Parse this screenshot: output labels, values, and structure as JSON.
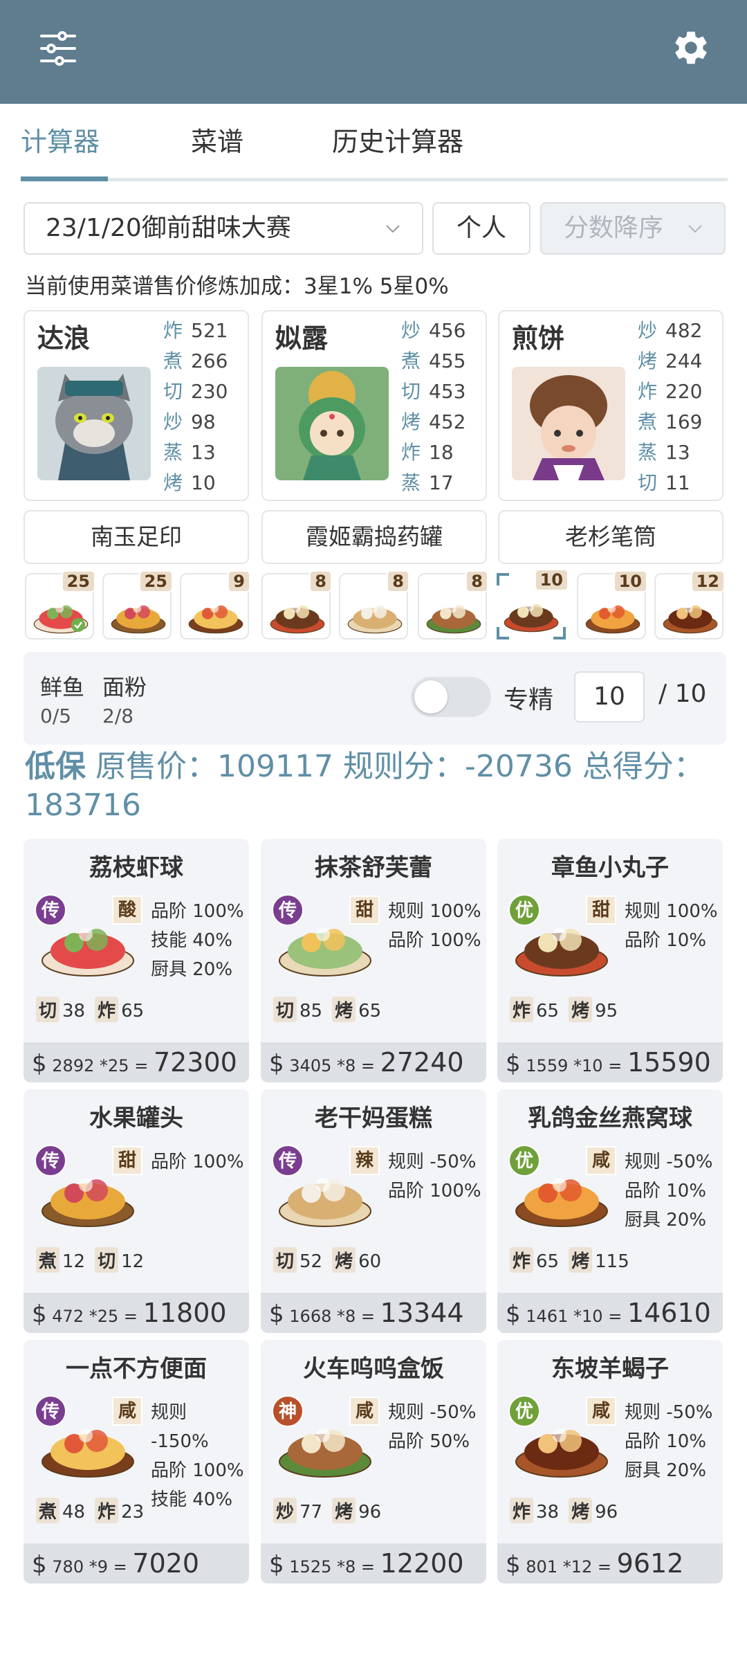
{
  "header": {
    "menu_icon": "sliders-icon",
    "settings_icon": "gear-icon",
    "bg_color": "#5f7d8f"
  },
  "tabs": [
    {
      "label": "计算器",
      "active": true
    },
    {
      "label": "菜谱",
      "active": false
    },
    {
      "label": "历史计算器",
      "active": false
    }
  ],
  "filters": {
    "contest": "23/1/20御前甜味大赛",
    "mode": "个人",
    "sort": "分数降序"
  },
  "hint": "当前使用菜谱售价修炼加成：3星1% 5星0%",
  "chefs": [
    {
      "name": "达浪",
      "stats": [
        {
          "k": "炸",
          "v": "521"
        },
        {
          "k": "煮",
          "v": "266"
        },
        {
          "k": "切",
          "v": "230"
        },
        {
          "k": "炒",
          "v": "98"
        },
        {
          "k": "蒸",
          "v": "13"
        },
        {
          "k": "烤",
          "v": "10"
        }
      ],
      "equip": "南玉足印"
    },
    {
      "name": "姒露",
      "stats": [
        {
          "k": "炒",
          "v": "456"
        },
        {
          "k": "煮",
          "v": "455"
        },
        {
          "k": "切",
          "v": "453"
        },
        {
          "k": "烤",
          "v": "452"
        },
        {
          "k": "炸",
          "v": "18"
        },
        {
          "k": "蒸",
          "v": "17"
        }
      ],
      "equip": "霞姬霸捣药罐"
    },
    {
      "name": "煎饼",
      "stats": [
        {
          "k": "炒",
          "v": "482"
        },
        {
          "k": "烤",
          "v": "244"
        },
        {
          "k": "炸",
          "v": "220"
        },
        {
          "k": "煮",
          "v": "169"
        },
        {
          "k": "蒸",
          "v": "13"
        },
        {
          "k": "切",
          "v": "11"
        }
      ],
      "equip": "老杉笔筒"
    }
  ],
  "strip_counts": [
    "25",
    "25",
    "9",
    "8",
    "8",
    "8",
    "10",
    "10",
    "12"
  ],
  "panel": {
    "ing1_name": "鲜鱼",
    "ing1_val": "0/5",
    "ing2_name": "面粉",
    "ing2_val": "2/8",
    "toggle_label": "专精",
    "count_value": "10",
    "count_max": "/ 10"
  },
  "summary": {
    "tag": "低保",
    "text1": "原售价：",
    "orig": "109117",
    "text2": "规则分：",
    "rule": "-20736",
    "text3": "总得分：",
    "total": "183716"
  },
  "recipes": [
    {
      "name": "荔枝虾球",
      "rarity": "传",
      "taste": "酸",
      "bonus": [
        "品阶 100%",
        "技能 40%",
        "厨具 20%"
      ],
      "skills": [
        {
          "k": "切",
          "v": "38"
        },
        {
          "k": "炸",
          "v": "65"
        }
      ],
      "price": "2892",
      "mult": "*25",
      "total": "72300"
    },
    {
      "name": "抹茶舒芙蕾",
      "rarity": "传",
      "taste": "甜",
      "bonus": [
        "规则 100%",
        "品阶 100%"
      ],
      "skills": [
        {
          "k": "切",
          "v": "85"
        },
        {
          "k": "烤",
          "v": "65"
        }
      ],
      "price": "3405",
      "mult": "*8",
      "total": "27240"
    },
    {
      "name": "章鱼小丸子",
      "rarity": "优",
      "taste": "甜",
      "bonus": [
        "规则 100%",
        "品阶 10%"
      ],
      "skills": [
        {
          "k": "炸",
          "v": "65"
        },
        {
          "k": "烤",
          "v": "95"
        }
      ],
      "price": "1559",
      "mult": "*10",
      "total": "15590"
    },
    {
      "name": "水果罐头",
      "rarity": "传",
      "taste": "甜",
      "bonus": [
        "品阶 100%"
      ],
      "skills": [
        {
          "k": "煮",
          "v": "12"
        },
        {
          "k": "切",
          "v": "12"
        }
      ],
      "price": "472",
      "mult": "*25",
      "total": "11800"
    },
    {
      "name": "老干妈蛋糕",
      "rarity": "传",
      "taste": "辣",
      "bonus": [
        "规则 -50%",
        "品阶 100%"
      ],
      "skills": [
        {
          "k": "切",
          "v": "52"
        },
        {
          "k": "烤",
          "v": "60"
        }
      ],
      "price": "1668",
      "mult": "*8",
      "total": "13344"
    },
    {
      "name": "乳鸽金丝燕窝球",
      "rarity": "优",
      "taste": "咸",
      "bonus": [
        "规则 -50%",
        "品阶 10%",
        "厨具 20%"
      ],
      "skills": [
        {
          "k": "炸",
          "v": "65"
        },
        {
          "k": "烤",
          "v": "115"
        }
      ],
      "price": "1461",
      "mult": "*10",
      "total": "14610"
    },
    {
      "name": "一点不方便面",
      "rarity": "传",
      "taste": "咸",
      "bonus": [
        "规则 -150%",
        "品阶 100%",
        "技能 40%"
      ],
      "skills": [
        {
          "k": "煮",
          "v": "48"
        },
        {
          "k": "炸",
          "v": "23"
        }
      ],
      "price": "780",
      "mult": "*9",
      "total": "7020"
    },
    {
      "name": "火车呜呜盒饭",
      "rarity": "神",
      "taste": "咸",
      "bonus": [
        "规则 -50%",
        "品阶 50%"
      ],
      "skills": [
        {
          "k": "炒",
          "v": "77"
        },
        {
          "k": "烤",
          "v": "96"
        }
      ],
      "price": "1525",
      "mult": "*8",
      "total": "12200"
    },
    {
      "name": "东坡羊蝎子",
      "rarity": "优",
      "taste": "咸",
      "bonus": [
        "规则 -50%",
        "品阶 10%",
        "厨具 20%"
      ],
      "skills": [
        {
          "k": "炸",
          "v": "38"
        },
        {
          "k": "烤",
          "v": "96"
        }
      ],
      "price": "801",
      "mult": "*12",
      "total": "9612"
    }
  ],
  "rarity_colors": {
    "传": "#7a3d8f",
    "优": "#6fa03a",
    "神": "#b8502a"
  }
}
